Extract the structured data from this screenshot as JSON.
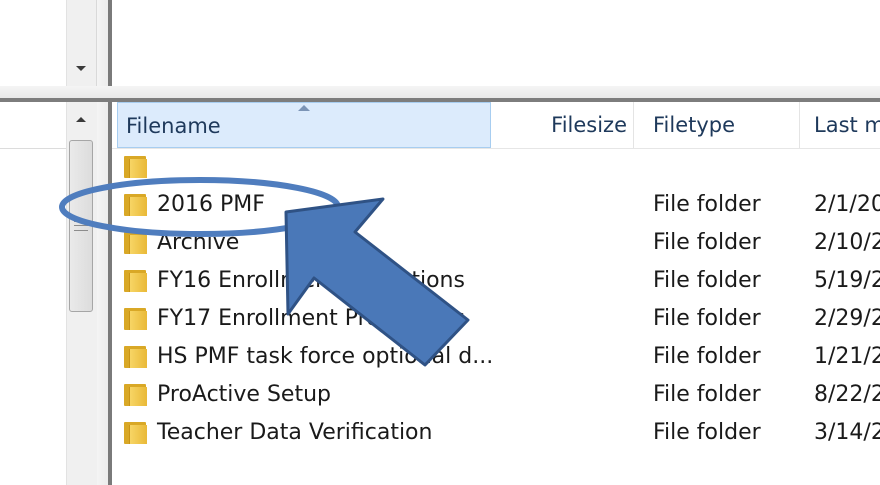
{
  "columns": {
    "filename": "Filename",
    "filesize": "Filesize",
    "filetype": "Filetype",
    "last_modified": "Last m"
  },
  "rows": [
    {
      "name": "",
      "type": "",
      "date": ""
    },
    {
      "name": "2016 PMF",
      "type": "File folder",
      "date": "2/1/20"
    },
    {
      "name": "Archive",
      "type": "File folder",
      "date": "2/10/2"
    },
    {
      "name": "FY16 Enrollment Projections",
      "type": "File folder",
      "date": "5/19/2"
    },
    {
      "name": "FY17 Enrollment Projections",
      "type": "File folder",
      "date": "2/29/2"
    },
    {
      "name": "HS PMF task force optional d...",
      "type": "File folder",
      "date": "1/21/2"
    },
    {
      "name": "ProActive Setup",
      "type": "File folder",
      "date": "8/22/2"
    },
    {
      "name": "Teacher Data Verification",
      "type": "File folder",
      "date": "3/14/2"
    }
  ],
  "icons": {
    "folder": "folder-icon",
    "sort": "sort-ascending-icon",
    "scroll_up": "scroll-up-arrow-icon",
    "dropdown": "dropdown-arrow-icon"
  },
  "annotation": {
    "highlight_color": "#4f7dbe",
    "arrow_fill": "#4a78b8",
    "arrow_stroke": "#2f5285"
  }
}
